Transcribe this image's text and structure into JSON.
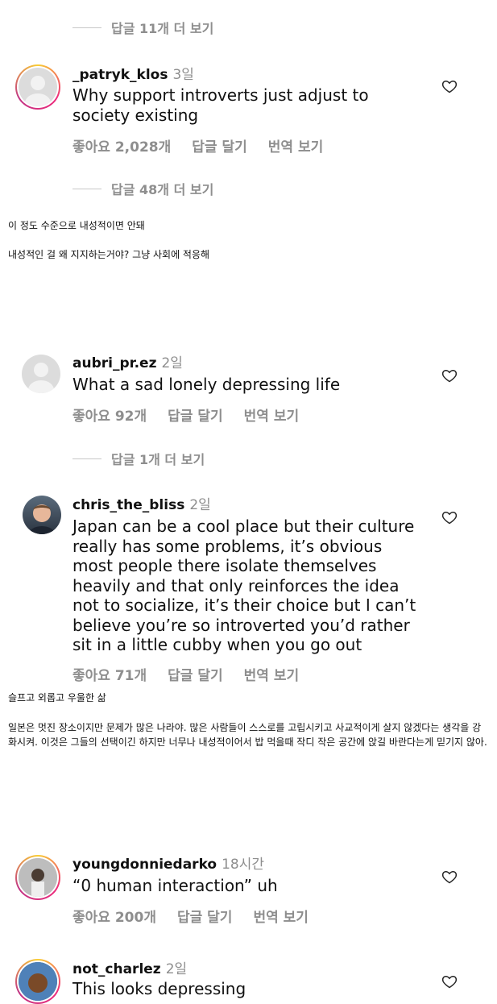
{
  "comments": [
    {
      "username": "_patryk_klos",
      "time": "3일",
      "text": "Why support introverts just adjust to society existing",
      "likes": "좋아요 2,028개",
      "reply": "답글 달기",
      "translate": "번역 보기"
    },
    {
      "username": "aubri_pr.ez",
      "time": "2일",
      "text": "What a sad lonely depressing life",
      "likes": "좋아요 92개",
      "reply": "답글 달기",
      "translate": "번역 보기"
    },
    {
      "username": "chris_the_bliss",
      "time": "2일",
      "text": "Japan can be a cool place but their culture really has some problems, it’s obvious most people there isolate themselves heavily and that only reinforces the idea not to socialize, it’s their choice but I can’t believe you’re so introverted you’d rather sit in a little cubby when you go out",
      "likes": "좋아요 71개",
      "reply": "답글 달기",
      "translate": "번역 보기"
    },
    {
      "username": "youngdonniedarko",
      "time": "18시간",
      "text": "“0 human interaction” uh",
      "likes": "좋아요 200개",
      "reply": "답글 달기",
      "translate": "번역 보기"
    },
    {
      "username": "not_charlez",
      "time": "2일",
      "text": "This looks depressing"
    }
  ],
  "view_replies": [
    "답글 11개 더 보기",
    "답글 48개 더 보기",
    "답글 1개 더 보기"
  ],
  "translations": {
    "t1a": "이 정도 수준으로 내성적이면 안돼",
    "t1b": "내성적인 걸 왜 지지하는거야? 그냥 사회에 적응해",
    "t2": "슬프고 외롭고 우울한 삶",
    "t3": "일본은 멋진 장소이지만 문제가 많은 나라야. 많은 사람들이 스스로를 고립시키고 사교적이게 살지 않겠다는 생각을 강화시켜. 이것은 그들의 선택이긴 하지만 너무나 내성적이어서 밥 먹을때 작디 작은 공간에 앉길 바란다는게 믿기지 않아."
  }
}
